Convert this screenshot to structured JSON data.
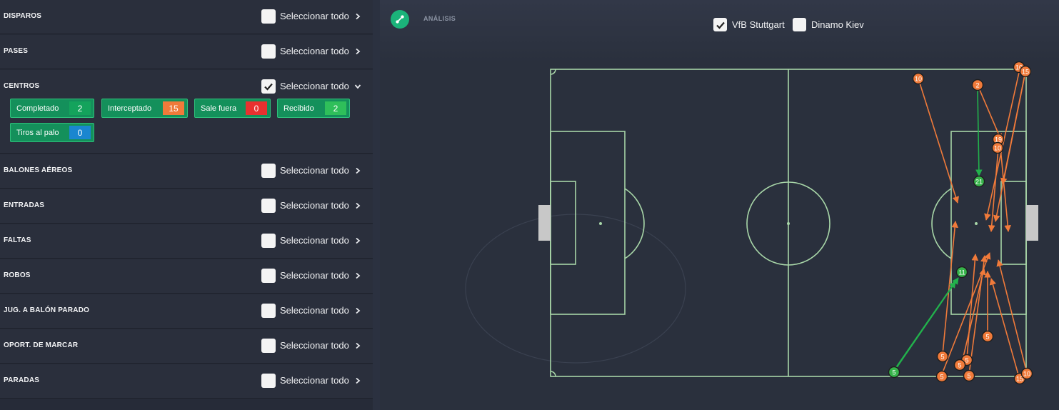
{
  "sections": [
    {
      "title": "DISPAROS",
      "select_label": "Seleccionar todo",
      "checked": false,
      "expanded": false
    },
    {
      "title": "PASES",
      "select_label": "Seleccionar todo",
      "checked": false,
      "expanded": false
    },
    {
      "title": "CENTROS",
      "select_label": "Seleccionar todo",
      "checked": true,
      "expanded": true
    },
    {
      "title": "BALONES AÉREOS",
      "select_label": "Seleccionar todo",
      "checked": false,
      "expanded": false
    },
    {
      "title": "ENTRADAS",
      "select_label": "Seleccionar todo",
      "checked": false,
      "expanded": false
    },
    {
      "title": "FALTAS",
      "select_label": "Seleccionar todo",
      "checked": false,
      "expanded": false
    },
    {
      "title": "ROBOS",
      "select_label": "Seleccionar todo",
      "checked": false,
      "expanded": false
    },
    {
      "title": "JUG. A BALÓN PARADO",
      "select_label": "Seleccionar todo",
      "checked": false,
      "expanded": false
    },
    {
      "title": "OPORT. DE MARCAR",
      "select_label": "Seleccionar todo",
      "checked": false,
      "expanded": false
    },
    {
      "title": "PARADAS",
      "select_label": "Seleccionar todo",
      "checked": false,
      "expanded": false
    }
  ],
  "centros_items": [
    {
      "label": "Completado",
      "count": "2",
      "count_color": "#14a35c"
    },
    {
      "label": "Interceptado",
      "count": "15",
      "count_color": "#f07a3a"
    },
    {
      "label": "Sale fuera",
      "count": "0",
      "count_color": "#e8312f"
    },
    {
      "label": "Recibido",
      "count": "2",
      "count_color": "#2fbf5a"
    },
    {
      "label": "Tiros al palo",
      "count": "0",
      "count_color": "#1a86d0"
    }
  ],
  "header": {
    "analysis_label": "ANÁLISIS",
    "teams": [
      {
        "name": "VfB Stuttgart",
        "checked": true
      },
      {
        "name": "Dinamo Kiev",
        "checked": false
      }
    ]
  },
  "colors": {
    "accent": "#1bb37a",
    "intercepted": "#f07a3a",
    "completed": "#2fbf5a",
    "pitch_lines": "#a8d6a8"
  },
  "pitch_events": {
    "completed": [
      {
        "from": "2",
        "to": "21"
      },
      {
        "from": "5",
        "to": "11"
      }
    ],
    "player_markers": [
      {
        "label": "10",
        "team": "orange"
      },
      {
        "label": "2",
        "team": "orange"
      },
      {
        "label": "10",
        "team": "orange"
      },
      {
        "label": "15",
        "team": "orange"
      },
      {
        "label": "19",
        "team": "orange"
      },
      {
        "label": "10",
        "team": "orange"
      },
      {
        "label": "21",
        "team": "green"
      },
      {
        "label": "11",
        "team": "green"
      },
      {
        "label": "5",
        "team": "orange"
      },
      {
        "label": "5",
        "team": "orange"
      },
      {
        "label": "5",
        "team": "orange"
      },
      {
        "label": "5",
        "team": "orange"
      },
      {
        "label": "5",
        "team": "orange"
      },
      {
        "label": "5",
        "team": "orange"
      },
      {
        "label": "5",
        "team": "green"
      },
      {
        "label": "15",
        "team": "orange"
      },
      {
        "label": "10",
        "team": "orange"
      }
    ]
  }
}
